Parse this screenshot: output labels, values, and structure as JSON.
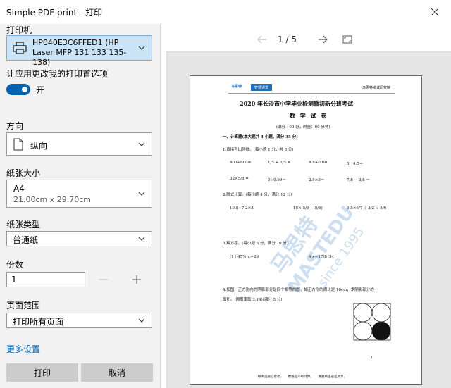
{
  "window": {
    "title": "Simple PDF print - 打印"
  },
  "printer": {
    "section_label": "打印机",
    "name": "HP040E3C6FFED1 (HP Laser MFP 131 133 135-138)"
  },
  "preference": {
    "label": "让应用更改我的打印首选项",
    "toggle_state": "开"
  },
  "orientation": {
    "label": "方向",
    "value": "纵向"
  },
  "paper_size": {
    "label": "纸张大小",
    "value": "A4",
    "dimensions": "21.00cm x 29.70cm"
  },
  "paper_type": {
    "label": "纸张类型",
    "value": "普通纸"
  },
  "copies": {
    "label": "份数",
    "value": "1"
  },
  "page_range": {
    "label": "页面范围",
    "value": "打印所有页面"
  },
  "more_settings": "更多设置",
  "buttons": {
    "print": "打印",
    "cancel": "取消"
  },
  "preview": {
    "page_indicator": "1 / 5",
    "document": {
      "logo_text": "马思特",
      "logo_badge": "智慧课堂",
      "header_right": "马思特考试研究院",
      "title": "2020 年长沙市小学毕业检测暨初新分班考试",
      "subject": "数 学 试 卷",
      "score": "(满分 100 分，时量：60 分钟)",
      "section1": "一、计算题(本大题共 4 小题，满分 35 分)",
      "q1": "1.直接写出得数。(每小题 1 分，共 8 分)",
      "q1_row1": [
        "400÷600=",
        "1/5 + 3/5 =",
        "4.8÷0.6=",
        "5－4.5＝"
      ],
      "q1_row2": [
        "32×5/8 =",
        "0÷0.99＝",
        "2.5×3＝",
        "7/8 − 3/8 ＝"
      ],
      "q2": "2.脱式计算。(每小题 4 分，满分 12 分)",
      "q2_row": [
        "10.8÷7.2×8",
        "18×(5/9 − 5/6)",
        "3.5×6/7 + 3/2 ÷ 5/6"
      ],
      "q3": "3.解方程。(每小题 5 分，满分 10 分)",
      "q3_row": [
        "(1＋45%)x＝29",
        "4∶x＝17/8 ∶34"
      ],
      "q4a": "4.如图，正方形内的阴影部分是四个相等的圆，如正方形的周长是 16cm，求阴影部分的",
      "q4b": "面积。(圆周率取 3.14)(满分 5 分)",
      "page_number": "1",
      "footer": "概率是很心思考。　　数看是不断计算。　　做题目还必是调节。",
      "watermark": "马思特 MASTEDU since 1995"
    }
  }
}
